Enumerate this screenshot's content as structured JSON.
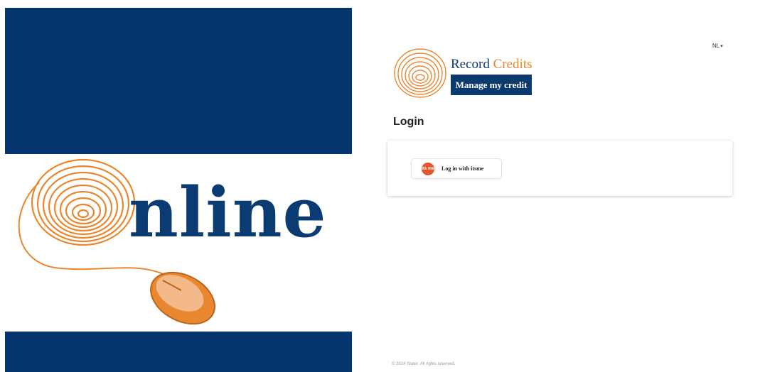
{
  "hero": {
    "word": "nline",
    "colors": {
      "navy": "#04356f",
      "orange": "#e8872f"
    },
    "icons": [
      "fingerprint-icon",
      "computer-mouse-icon"
    ]
  },
  "language": {
    "selected": "NL",
    "chevron_icon": "chevron-down-icon"
  },
  "brand": {
    "record": "Record",
    "credits": "Credits",
    "tagline": "Manage my credit",
    "logo_icon": "fingerprint-logo-icon",
    "colors": {
      "navy": "#0c3a6e",
      "orange": "#e8872f"
    }
  },
  "login": {
    "title": "Login",
    "itsme_label": "Log in with itsme",
    "itsme_icon_text": "its me",
    "itsme_color": "#e4572e"
  },
  "footer": {
    "copyright": "© 2024 Stater. All rights reserved."
  }
}
